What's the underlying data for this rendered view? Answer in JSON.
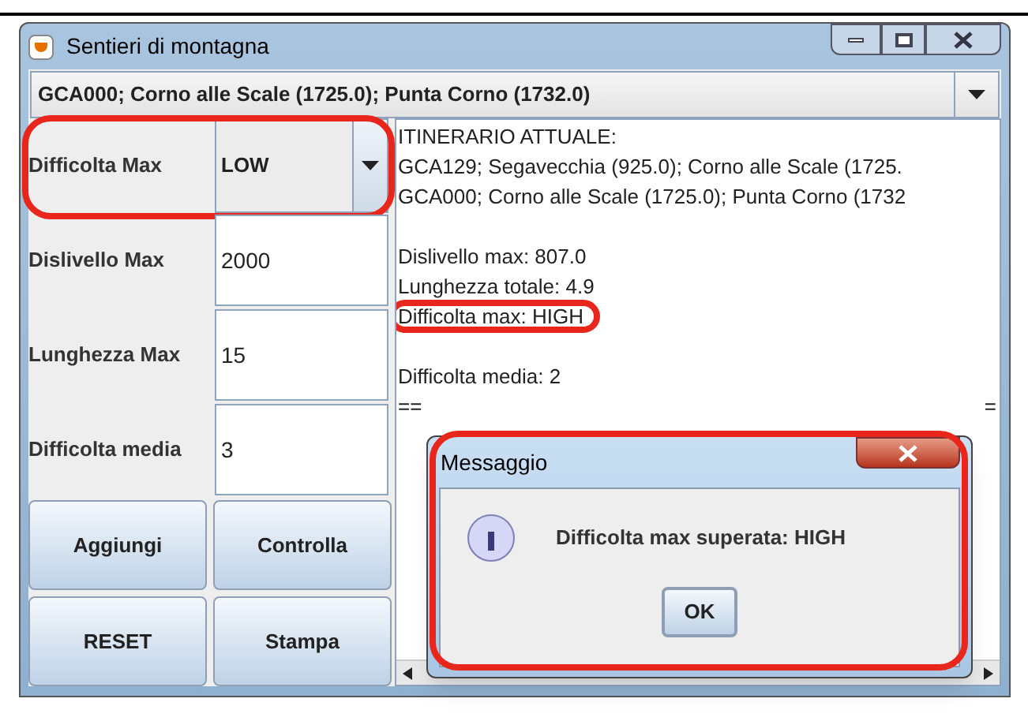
{
  "window": {
    "title": "Sentieri di montagna"
  },
  "route_combo": {
    "value": "GCA000; Corno alle Scale (1725.0); Punta Corno (1732.0)"
  },
  "form": [
    {
      "kind": "select",
      "label": "Difficolta Max",
      "value": "LOW",
      "highlighted": true
    },
    {
      "kind": "field",
      "label": "Dislivello Max",
      "value": "2000",
      "highlighted": false
    },
    {
      "kind": "field",
      "label": "Lunghezza Max",
      "value": "15",
      "highlighted": false
    },
    {
      "kind": "field",
      "label": "Difficolta media",
      "value": "3",
      "highlighted": false
    }
  ],
  "buttons": [
    "Aggiungi",
    "Controlla",
    "RESET",
    "Stampa"
  ],
  "output_lines": [
    {
      "text": "ITINERARIO ATTUALE:",
      "highlighted": false
    },
    {
      "text": "GCA129; Segavecchia (925.0); Corno alle Scale (1725.",
      "highlighted": false
    },
    {
      "text": "GCA000; Corno alle Scale (1725.0); Punta Corno (1732",
      "highlighted": false
    },
    {
      "kind": "blank"
    },
    {
      "text": "Dislivello max:  807.0",
      "highlighted": false
    },
    {
      "text": "Lunghezza totale: 4.9",
      "highlighted": false
    },
    {
      "text": "Difficolta max:  HIGH",
      "highlighted": true
    },
    {
      "kind": "blank"
    },
    {
      "text": "Difficolta media: 2",
      "highlighted": false
    }
  ],
  "output_partial": {
    "left": "==",
    "right": "="
  },
  "dialog": {
    "title": "Messaggio",
    "message": "Difficolta max superata: HIGH",
    "button": "OK",
    "highlighted": true
  }
}
